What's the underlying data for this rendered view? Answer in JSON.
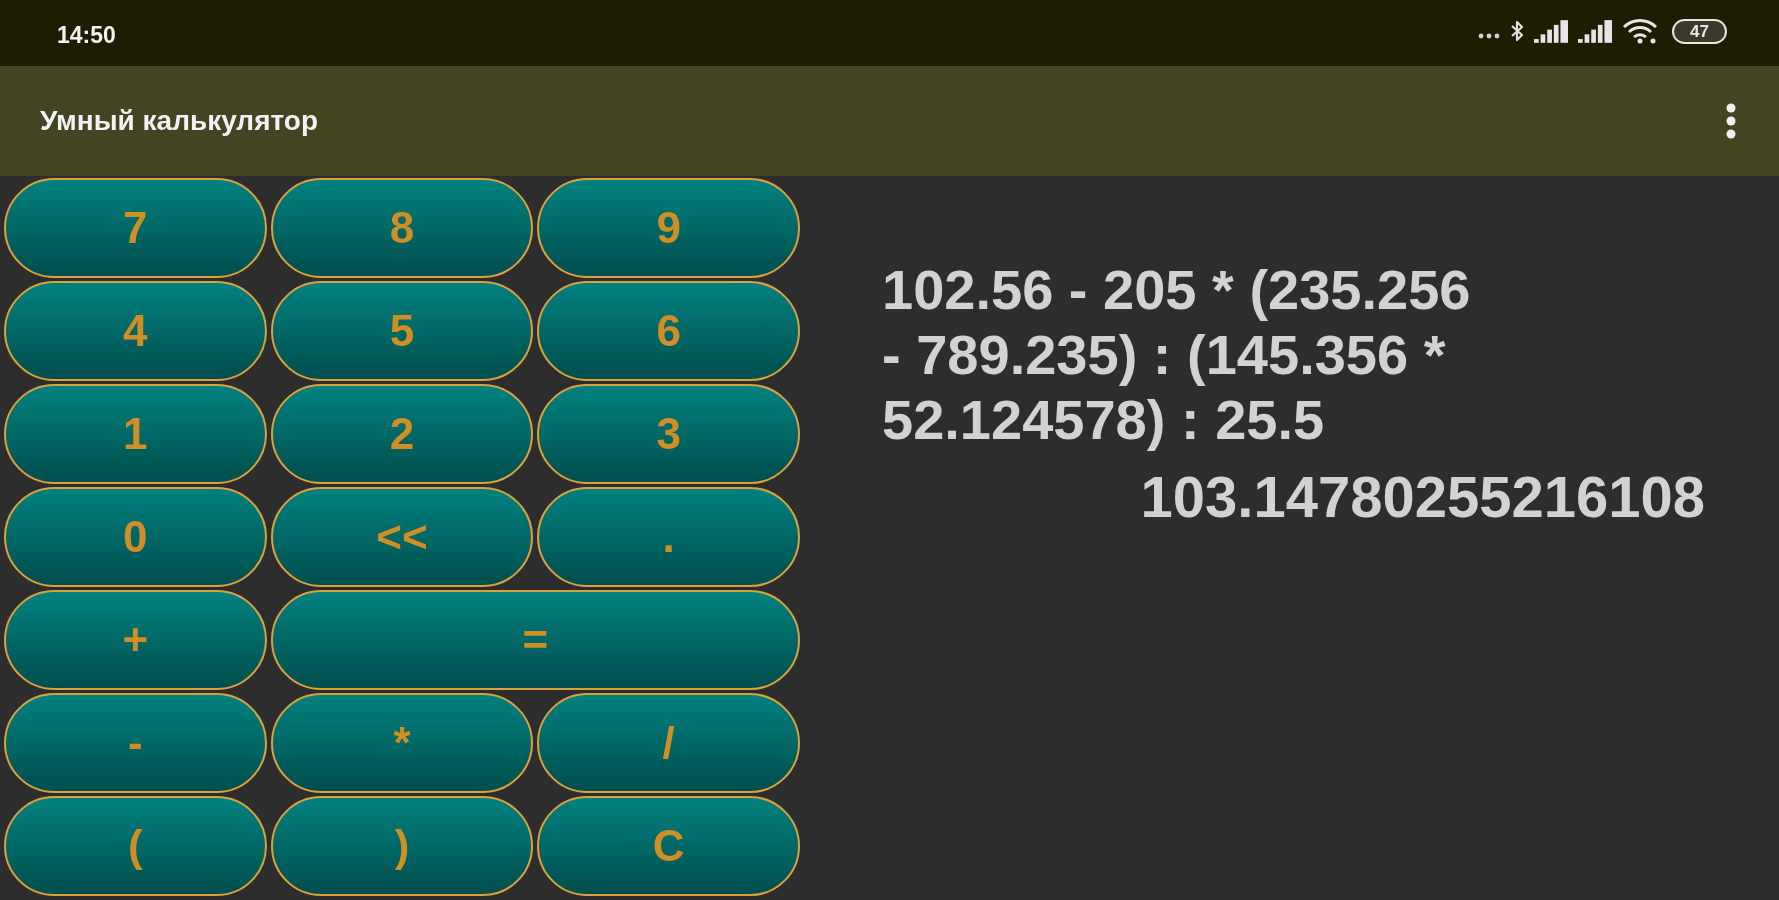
{
  "status_bar": {
    "time": "14:50",
    "battery": "47"
  },
  "app_bar": {
    "title": "Умный калькулятор"
  },
  "keypad": {
    "rows": [
      [
        {
          "label": "7",
          "wide": false
        },
        {
          "label": "8",
          "wide": false
        },
        {
          "label": "9",
          "wide": false
        }
      ],
      [
        {
          "label": "4",
          "wide": false
        },
        {
          "label": "5",
          "wide": false
        },
        {
          "label": "6",
          "wide": false
        }
      ],
      [
        {
          "label": "1",
          "wide": false
        },
        {
          "label": "2",
          "wide": false
        },
        {
          "label": "3",
          "wide": false
        }
      ],
      [
        {
          "label": "0",
          "wide": false
        },
        {
          "label": "<<",
          "wide": false
        },
        {
          "label": ".",
          "wide": false
        }
      ],
      [
        {
          "label": "+",
          "wide": false
        },
        {
          "label": "=",
          "wide": true
        }
      ],
      [
        {
          "label": "-",
          "wide": false
        },
        {
          "label": "*",
          "wide": false
        },
        {
          "label": "/",
          "wide": false
        }
      ],
      [
        {
          "label": "(",
          "wide": false
        },
        {
          "label": ")",
          "wide": false
        },
        {
          "label": "C",
          "wide": false
        }
      ]
    ]
  },
  "display": {
    "expression": "102.56 - 205 * (235.256 - 789.235) : (145.356 * 52.124578) : 25.5",
    "result": "103.14780255216108"
  }
}
